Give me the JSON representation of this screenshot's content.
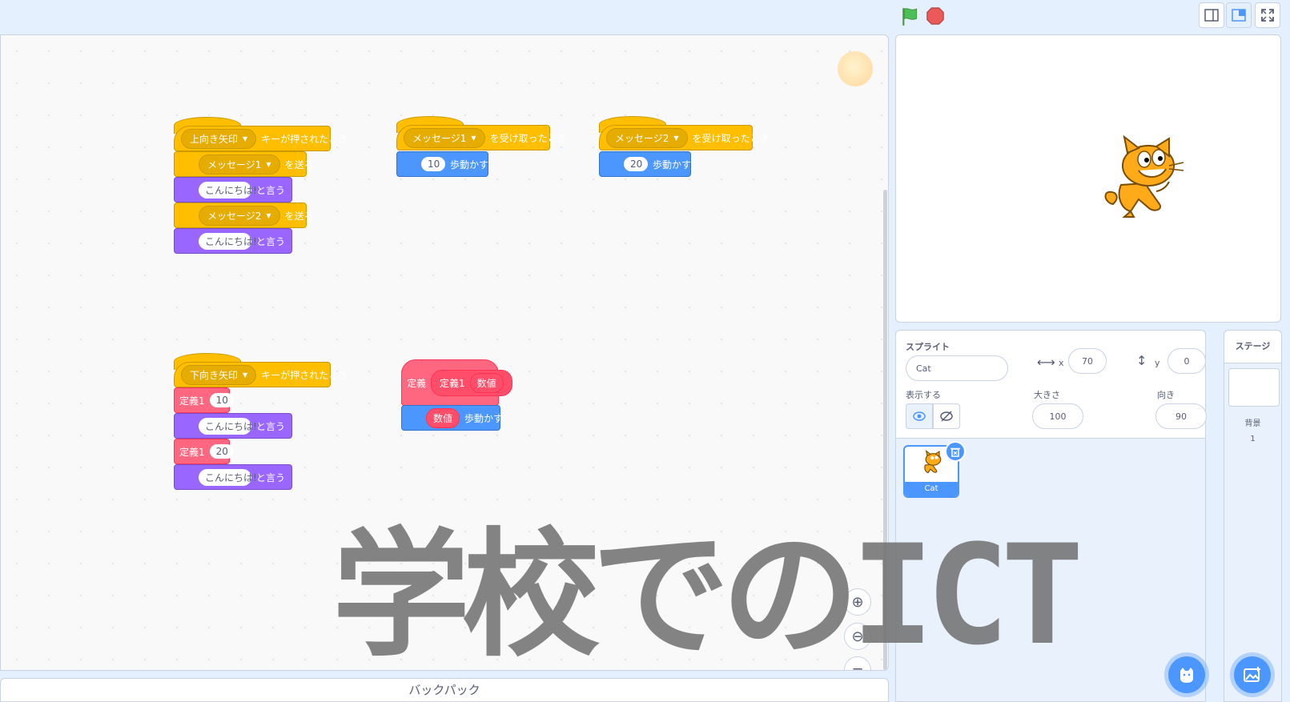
{
  "topbar": {
    "green_flag": "green-flag-icon",
    "stop": "stop-icon"
  },
  "workspace": {
    "script1": {
      "hat_key": "上向き矢印",
      "hat_suffix": "キーが押されたとき",
      "b1_msg": "メッセージ1",
      "b1_suffix": "を送る",
      "b2_text": "こんにちは!",
      "b2_suffix": "と言う",
      "b3_msg": "メッセージ2",
      "b3_suffix": "を送る",
      "b4_text": "こんにちは!",
      "b4_suffix": "と言う"
    },
    "script2": {
      "hat_msg": "メッセージ1",
      "hat_suffix": "を受け取ったとき",
      "steps": "10",
      "move_suffix": "歩動かす"
    },
    "script3": {
      "hat_msg": "メッセージ2",
      "hat_suffix": "を受け取ったとき",
      "steps": "20",
      "move_suffix": "歩動かす"
    },
    "script4": {
      "hat_key": "下向き矢印",
      "hat_suffix": "キーが押されたとき",
      "c1_label": "定義1",
      "c1_val": "10",
      "s1_text": "こんにちは!",
      "s1_suffix": "と言う",
      "c2_label": "定義1",
      "c2_val": "20",
      "s2_text": "こんにちは!",
      "s2_suffix": "と言う"
    },
    "script5": {
      "define_label": "定義",
      "proc_name": "定義1",
      "param": "数値",
      "move_arg": "数値",
      "move_suffix": "歩動かす"
    }
  },
  "backpack": {
    "label": "バックパック"
  },
  "sprite_info": {
    "title": "スプライト",
    "name": "Cat",
    "x_label": "x",
    "x_value": "70",
    "y_label": "y",
    "y_value": "0",
    "show_label": "表示する",
    "size_label": "大きさ",
    "size_value": "100",
    "direction_label": "向き",
    "direction_value": "90"
  },
  "sprite_list": [
    {
      "name": "Cat"
    }
  ],
  "stage_pane": {
    "title": "ステージ",
    "backdrop_label": "背景",
    "backdrop_count": "1"
  },
  "watermark": "学校でのICT",
  "colors": {
    "events": "#ffbf00",
    "looks": "#9966ff",
    "motion": "#4c97ff",
    "custom": "#ff6680",
    "accent": "#4c97ff"
  }
}
